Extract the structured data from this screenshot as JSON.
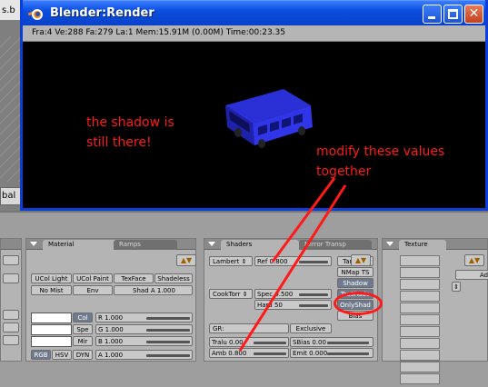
{
  "background_window": {
    "tab_label": "s.b",
    "side_label": "bal"
  },
  "render_window": {
    "title": "Blender:Render",
    "info": "Fra:4  Ve:288 Fa:279 La:1 Mem:15.91M (0.00M) Time:00:23.35",
    "buttons": {
      "minimize": "minimize",
      "maximize": "maximize",
      "close": "✕"
    }
  },
  "annotations": {
    "note_shadow_line1": "the shadow is",
    "note_shadow_line2": "still there!",
    "note_modify_line1": "modify these values",
    "note_modify_line2": "together",
    "color": "#ff1a1a"
  },
  "material_panel": {
    "tabs": [
      "Material",
      "Ramps"
    ],
    "row1": [
      "UCol Light",
      "UCol Paint",
      "TexFace",
      "Shadeless"
    ],
    "row2": {
      "nomist": "No Mist",
      "env": "Env",
      "shad_a": "Shad A 1.000"
    },
    "color_buttons": [
      "Col",
      "Spe",
      "Mir"
    ],
    "color_values": [
      "R 1.000",
      "G 1.000",
      "B 1.000",
      "A 1.000"
    ],
    "mode_buttons": [
      "RGB",
      "HSV",
      "DYN"
    ]
  },
  "shaders_panel": {
    "tabs": [
      "Shaders",
      "Mirror Transp"
    ],
    "diffuse": "Lambert",
    "ref": "Ref  0.800",
    "specular": "CookTorr",
    "spec": "Spec 0.500",
    "hard": "Hard 50",
    "gr_label": "GR:",
    "exclusive": "Exclusive",
    "tralu": "Tralu 0.00",
    "amb": "Amb 0.800",
    "sbias": "SBias 0.00",
    "emit": "Emit 0.000",
    "side_buttons": [
      "Tangent",
      "NMap TS",
      "Shadow",
      "TraShado",
      "OnlyShad",
      "Bias"
    ]
  },
  "texture_panel": {
    "tabs": [
      "Texture"
    ],
    "add_label": "Ad"
  }
}
